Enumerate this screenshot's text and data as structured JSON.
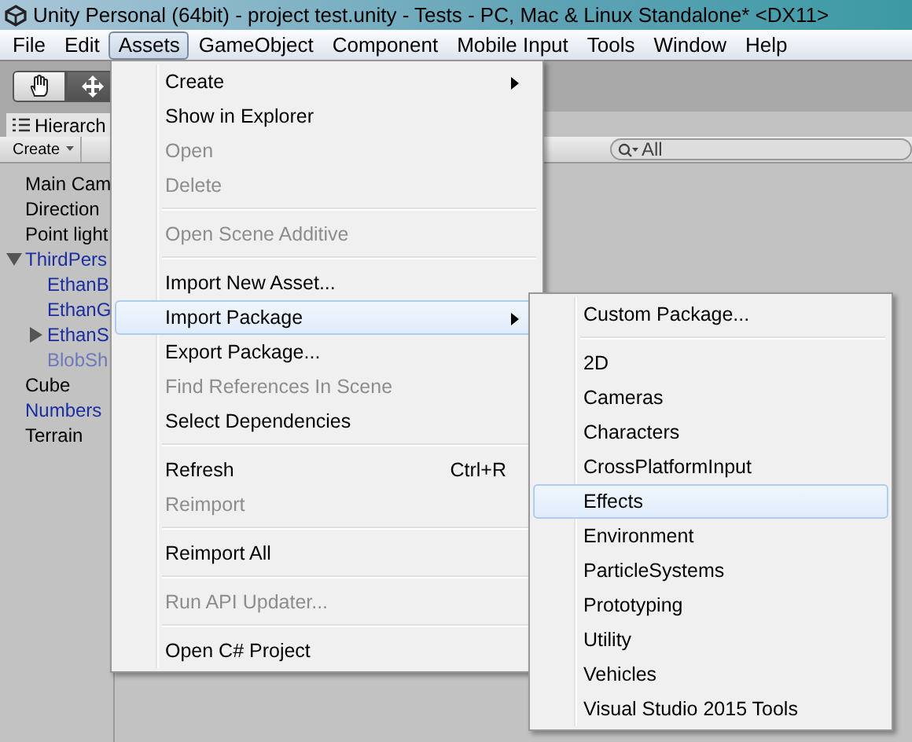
{
  "window": {
    "title": "Unity Personal (64bit) - project test.unity - Tests - PC, Mac & Linux Standalone* <DX11>"
  },
  "menubar": [
    {
      "label": "File",
      "selected": false
    },
    {
      "label": "Edit",
      "selected": false
    },
    {
      "label": "Assets",
      "selected": true
    },
    {
      "label": "GameObject",
      "selected": false
    },
    {
      "label": "Component",
      "selected": false
    },
    {
      "label": "Mobile Input",
      "selected": false
    },
    {
      "label": "Tools",
      "selected": false
    },
    {
      "label": "Window",
      "selected": false
    },
    {
      "label": "Help",
      "selected": false
    }
  ],
  "hierarchy": {
    "tab": "Hierarch",
    "create": "Create",
    "search": {
      "value": "All"
    },
    "items": [
      {
        "label": "Main Cam",
        "kind": "plain"
      },
      {
        "label": "Direction",
        "kind": "plain"
      },
      {
        "label": "Point light",
        "kind": "plain"
      },
      {
        "label": "ThirdPers",
        "kind": "prefab",
        "expanded": true,
        "children": [
          {
            "label": "EthanB",
            "kind": "prefab"
          },
          {
            "label": "EthanG",
            "kind": "prefab"
          },
          {
            "label": "EthanS",
            "kind": "prefab",
            "expanded": false
          },
          {
            "label": "BlobSh",
            "kind": "inactive"
          }
        ]
      },
      {
        "label": "Cube",
        "kind": "plain"
      },
      {
        "label": "Numbers",
        "kind": "prefab"
      },
      {
        "label": "Terrain",
        "kind": "plain"
      }
    ]
  },
  "assets_menu": [
    {
      "kind": "item",
      "label": "Create",
      "disabled": false,
      "submenu": true,
      "selected": false
    },
    {
      "kind": "item",
      "label": "Show in Explorer",
      "disabled": false,
      "submenu": false,
      "selected": false
    },
    {
      "kind": "item",
      "label": "Open",
      "disabled": true,
      "submenu": false,
      "selected": false
    },
    {
      "kind": "item",
      "label": "Delete",
      "disabled": true,
      "submenu": false,
      "selected": false
    },
    {
      "kind": "separator"
    },
    {
      "kind": "item",
      "label": "Open Scene Additive",
      "disabled": true,
      "submenu": false,
      "selected": false
    },
    {
      "kind": "separator"
    },
    {
      "kind": "item",
      "label": "Import New Asset...",
      "disabled": false,
      "submenu": false,
      "selected": false
    },
    {
      "kind": "item",
      "label": "Import Package",
      "disabled": false,
      "submenu": true,
      "selected": true
    },
    {
      "kind": "item",
      "label": "Export Package...",
      "disabled": false,
      "submenu": false,
      "selected": false
    },
    {
      "kind": "item",
      "label": "Find References In Scene",
      "disabled": true,
      "submenu": false,
      "selected": false
    },
    {
      "kind": "item",
      "label": "Select Dependencies",
      "disabled": false,
      "submenu": false,
      "selected": false
    },
    {
      "kind": "separator"
    },
    {
      "kind": "item",
      "label": "Refresh",
      "shortcut": "Ctrl+R",
      "disabled": false,
      "submenu": false,
      "selected": false
    },
    {
      "kind": "item",
      "label": "Reimport",
      "disabled": true,
      "submenu": false,
      "selected": false
    },
    {
      "kind": "separator"
    },
    {
      "kind": "item",
      "label": "Reimport All",
      "disabled": false,
      "submenu": false,
      "selected": false
    },
    {
      "kind": "separator"
    },
    {
      "kind": "item",
      "label": "Run API Updater...",
      "disabled": true,
      "submenu": false,
      "selected": false
    },
    {
      "kind": "separator"
    },
    {
      "kind": "item",
      "label": "Open C# Project",
      "disabled": false,
      "submenu": false,
      "selected": false
    }
  ],
  "import_package_menu": [
    {
      "kind": "item",
      "label": "Custom Package...",
      "selected": false
    },
    {
      "kind": "separator"
    },
    {
      "kind": "item",
      "label": "2D",
      "selected": false
    },
    {
      "kind": "item",
      "label": "Cameras",
      "selected": false
    },
    {
      "kind": "item",
      "label": "Characters",
      "selected": false
    },
    {
      "kind": "item",
      "label": "CrossPlatformInput",
      "selected": false
    },
    {
      "kind": "item",
      "label": "Effects",
      "selected": true
    },
    {
      "kind": "item",
      "label": "Environment",
      "selected": false
    },
    {
      "kind": "item",
      "label": "ParticleSystems",
      "selected": false
    },
    {
      "kind": "item",
      "label": "Prototyping",
      "selected": false
    },
    {
      "kind": "item",
      "label": "Utility",
      "selected": false
    },
    {
      "kind": "item",
      "label": "Vehicles",
      "selected": false
    },
    {
      "kind": "item",
      "label": "Visual Studio 2015 Tools",
      "selected": false
    }
  ]
}
